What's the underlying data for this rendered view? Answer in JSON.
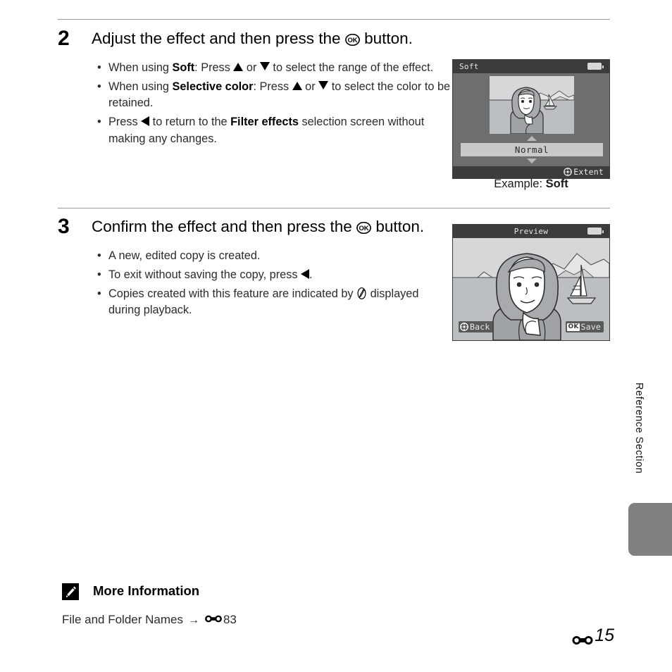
{
  "page": {
    "number_prefix_icon": "e-symbol-icon",
    "number": "15",
    "side_tab_label": "Reference Section"
  },
  "steps": [
    {
      "number": "2",
      "heading_before": "Adjust the effect and then press the",
      "heading_icon": "ok-button-icon",
      "heading_after": "button.",
      "bullets": [
        {
          "segments": [
            {
              "t": "When using ",
              "b": false
            },
            {
              "t": "Soft",
              "b": true
            },
            {
              "t": ": Press ",
              "b": false
            },
            {
              "t": "▲",
              "icon": "triangle-up-icon"
            },
            {
              "t": " or ",
              "b": false
            },
            {
              "t": "▼",
              "icon": "triangle-down-icon"
            },
            {
              "t": " to select the range of the effect.",
              "b": false
            }
          ]
        },
        {
          "segments": [
            {
              "t": "When using ",
              "b": false
            },
            {
              "t": "Selective color",
              "b": true
            },
            {
              "t": ": Press ",
              "b": false
            },
            {
              "t": "▲",
              "icon": "triangle-up-icon"
            },
            {
              "t": " or ",
              "b": false
            },
            {
              "t": "▼",
              "icon": "triangle-down-icon"
            },
            {
              "t": " to select the color to be retained.",
              "b": false
            }
          ]
        },
        {
          "segments": [
            {
              "t": "Press ",
              "b": false
            },
            {
              "t": "◀",
              "icon": "triangle-left-icon"
            },
            {
              "t": " to return to the ",
              "b": false
            },
            {
              "t": "Filter effects",
              "b": true
            },
            {
              "t": " selection screen without making any changes.",
              "b": false
            }
          ]
        }
      ]
    },
    {
      "number": "3",
      "heading_before": "Confirm the effect and then press the",
      "heading_icon": "ok-button-icon",
      "heading_after": "button.",
      "bullets": [
        {
          "segments": [
            {
              "t": "A new, edited copy is created.",
              "b": false
            }
          ]
        },
        {
          "segments": [
            {
              "t": "To exit without saving the copy, press ",
              "b": false
            },
            {
              "t": "◀",
              "icon": "triangle-left-icon"
            },
            {
              "t": ".",
              "b": false
            }
          ]
        },
        {
          "segments": [
            {
              "t": "Copies created with this feature are indicated by ",
              "b": false
            },
            {
              "t": "✎",
              "icon": "retouch-pencil-icon"
            },
            {
              "t": " displayed during playback.",
              "b": false
            }
          ]
        }
      ]
    }
  ],
  "screens": {
    "soft": {
      "title": "Soft",
      "battery_icon": "battery-full-icon",
      "selector_value": "Normal",
      "up_arrow_icon": "selector-up-arrow-icon",
      "down_arrow_icon": "selector-down-arrow-icon",
      "hint_icon": "rotary-multi-selector-icon",
      "hint_label": "Extent",
      "caption_prefix": "Example: ",
      "caption_value": "Soft"
    },
    "preview": {
      "title": "Preview",
      "battery_icon": "battery-full-icon",
      "back_badge_icon": "rotary-multi-selector-icon",
      "back_label": "Back",
      "save_badge": "OK",
      "save_label": "Save"
    }
  },
  "more_information": {
    "icon": "pencil-note-icon",
    "title": "More Information",
    "entry_label": "File and Folder Names",
    "arrow": "→",
    "ref_icon": "e-symbol-icon",
    "ref_page": "83"
  },
  "colors": {
    "rule": "#9a9a9a",
    "screen_bg": "#6e6e6e",
    "screen_bar": "#3c3c3c",
    "side_tab": "#808080",
    "text": "#231f20"
  }
}
